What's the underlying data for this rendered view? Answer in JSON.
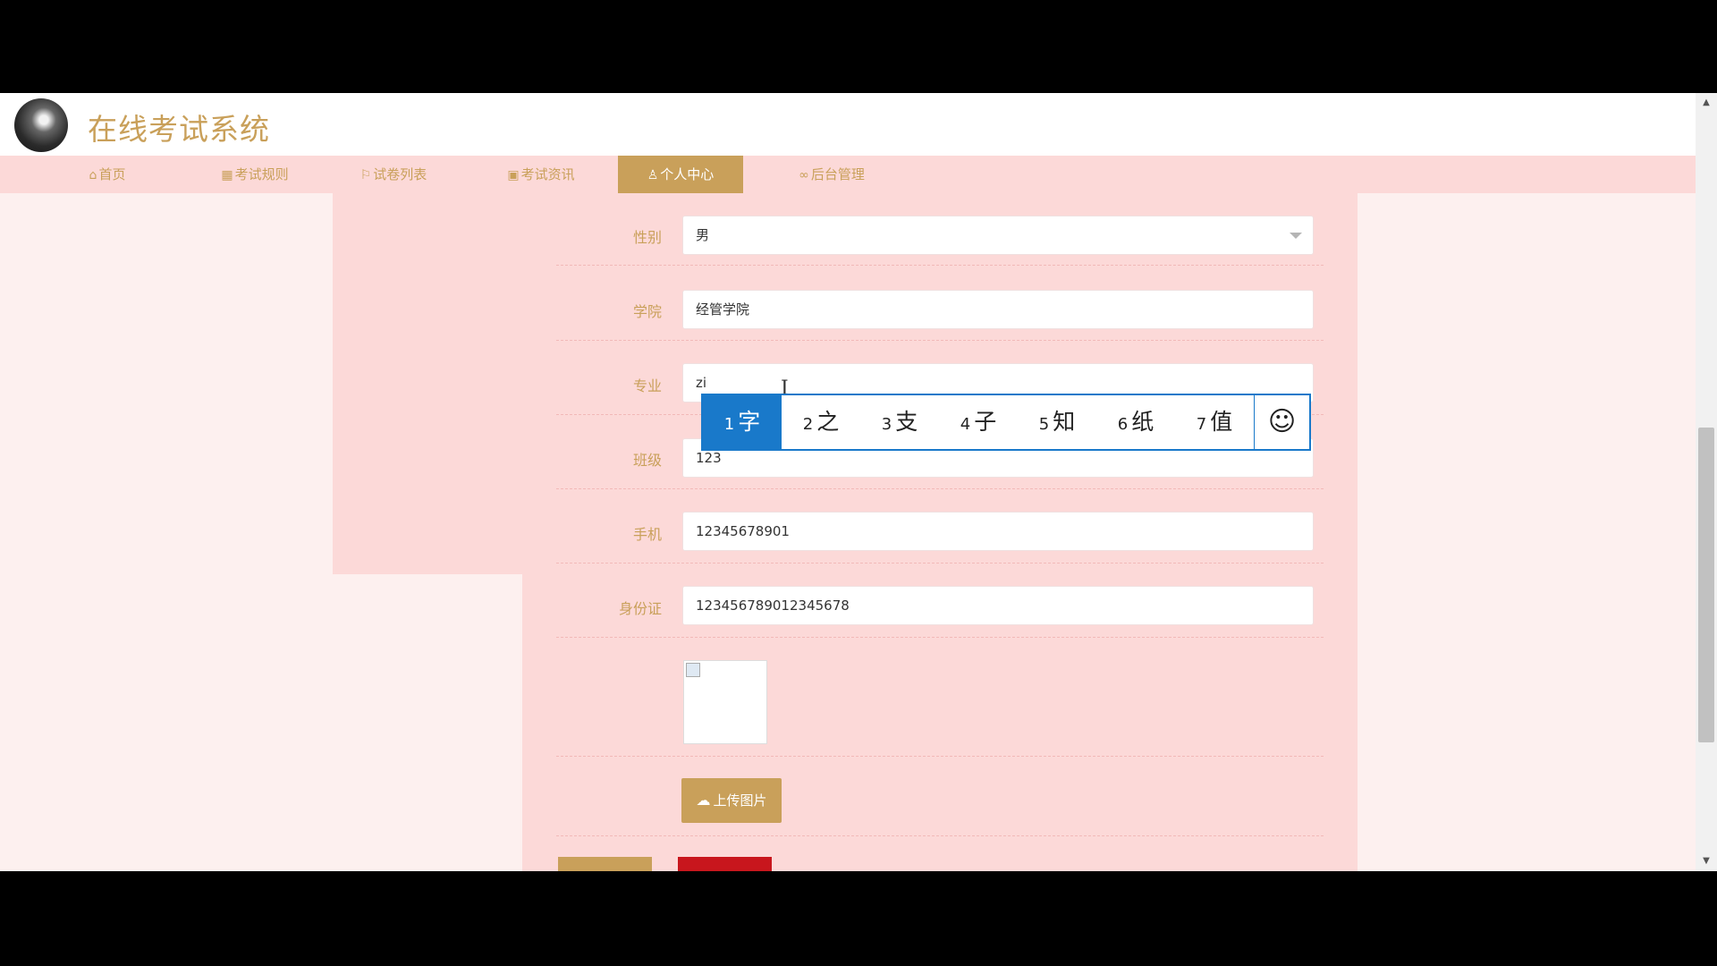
{
  "site": {
    "title": "在线考试系统"
  },
  "nav": {
    "items": [
      {
        "label": "首页",
        "icon": "home-icon"
      },
      {
        "label": "考试规则",
        "icon": "book-icon"
      },
      {
        "label": "试卷列表",
        "icon": "flag-icon"
      },
      {
        "label": "考试资讯",
        "icon": "news-icon"
      },
      {
        "label": "个人中心",
        "icon": "user-icon",
        "active": true
      },
      {
        "label": "后台管理",
        "icon": "link-icon"
      }
    ]
  },
  "form": {
    "gender": {
      "label": "性别",
      "value": "男"
    },
    "college": {
      "label": "学院",
      "value": "经管学院"
    },
    "major": {
      "label": "专业",
      "value": "zi"
    },
    "class": {
      "label": "班级",
      "value": "123"
    },
    "phone": {
      "label": "手机",
      "value": "12345678901"
    },
    "idcard": {
      "label": "身份证",
      "value": "123456789012345678"
    },
    "upload_label": "上传图片"
  },
  "ime": {
    "candidates": [
      {
        "num": "1",
        "char": "字"
      },
      {
        "num": "2",
        "char": "之"
      },
      {
        "num": "3",
        "char": "支"
      },
      {
        "num": "4",
        "char": "子"
      },
      {
        "num": "5",
        "char": "知"
      },
      {
        "num": "6",
        "char": "纸"
      },
      {
        "num": "7",
        "char": "值"
      }
    ],
    "emoji_icon": "smiley-icon"
  },
  "colors": {
    "accent": "#c9a05a",
    "panel": "#fcd9d8",
    "page_bg": "#fdf0ef",
    "ime_blue": "#1979ca",
    "danger": "#c8161d"
  }
}
